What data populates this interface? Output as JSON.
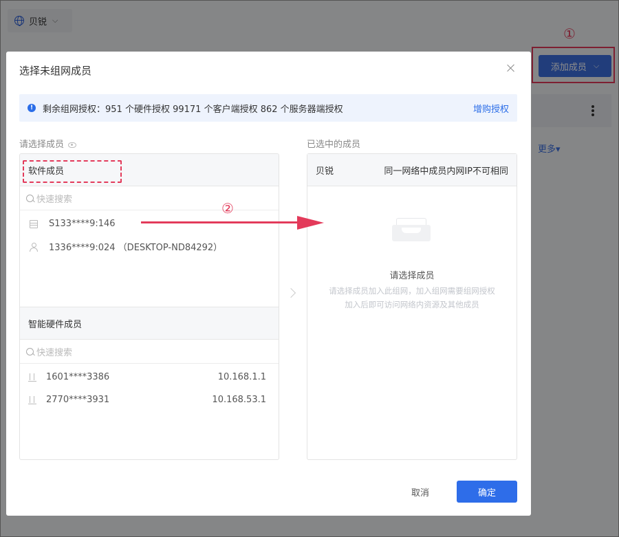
{
  "background": {
    "org_name": "贝锐",
    "add_member_label": "添加成员",
    "more_label": "更多▾"
  },
  "annotations": {
    "step1": "①",
    "step2": "②"
  },
  "dialog": {
    "title": "选择未组网成员",
    "info": {
      "text": "剩余组网授权：951 个硬件授权   99171 个客户端授权   862 个服务器端授权",
      "buy_link": "增购授权"
    },
    "left": {
      "label": "请选择成员",
      "software": {
        "title": "软件成员",
        "search_placeholder": "快速搜索",
        "items": [
          {
            "name": "S133****9:146",
            "icon": "server-icon"
          },
          {
            "name": "1336****9:024 （DESKTOP-ND84292）",
            "icon": "user-icon"
          }
        ]
      },
      "hardware": {
        "title": "智能硬件成员",
        "search_placeholder": "快速搜索",
        "items": [
          {
            "name": "1601****3386",
            "ip": "10.168.1.1",
            "icon": "router-icon"
          },
          {
            "name": "2770****3931",
            "ip": "10.168.53.1",
            "icon": "router-icon"
          }
        ]
      }
    },
    "right": {
      "label": "已选中的成员",
      "network_name": "贝锐",
      "hint": "同一网络中成员内网IP不可相同",
      "empty_title": "请选择成员",
      "empty_desc_1": "请选择成员加入此组网，加入组网需要组网授权",
      "empty_desc_2": "加入后即可访问网络内资源及其他成员"
    },
    "buttons": {
      "cancel": "取消",
      "ok": "确定"
    }
  },
  "colors": {
    "primary": "#2e6de9",
    "annotation": "#e33a5a"
  }
}
